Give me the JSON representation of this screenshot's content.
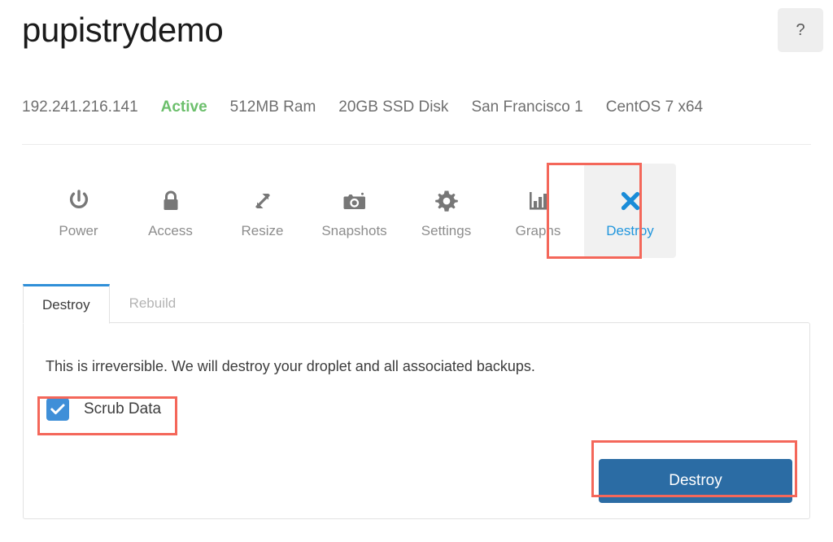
{
  "header": {
    "droplet_name": "pupistrydemo",
    "help_label": "?",
    "help_icon": "question-mark-icon"
  },
  "meta": {
    "items": [
      {
        "label": "192.241.216.141",
        "kind": "ip-address"
      },
      {
        "label": "Active",
        "kind": "status"
      },
      {
        "label": "512MB Ram",
        "kind": "memory"
      },
      {
        "label": "20GB SSD Disk",
        "kind": "disk"
      },
      {
        "label": "San Francisco 1",
        "kind": "region"
      },
      {
        "label": "CentOS 7 x64",
        "kind": "os"
      }
    ]
  },
  "icon_tabs": [
    {
      "label": "Power",
      "icon": "power-icon",
      "active": false
    },
    {
      "label": "Access",
      "icon": "lock-icon",
      "active": false
    },
    {
      "label": "Resize",
      "icon": "resize-icon",
      "active": false
    },
    {
      "label": "Snapshots",
      "icon": "camera-icon",
      "active": false
    },
    {
      "label": "Settings",
      "icon": "gear-icon",
      "active": false
    },
    {
      "label": "Graphs",
      "icon": "bar-chart-icon",
      "active": false
    },
    {
      "label": "Destroy",
      "icon": "x-close-icon",
      "active": true
    }
  ],
  "panel": {
    "tabs": [
      {
        "label": "Destroy",
        "active": true
      },
      {
        "label": "Rebuild",
        "active": false
      }
    ],
    "warning_text": "This is irreversible. We will destroy your droplet and all associated backups.",
    "scrub": {
      "label": "Scrub Data",
      "checked": true,
      "check_icon": "checkmark-icon"
    },
    "submit_label": "Destroy"
  },
  "colors": {
    "accent_blue": "#2196dd",
    "button_blue": "#2b6ca4",
    "checkbox_blue": "#3f8fd8",
    "status_green": "#6cbf6c",
    "annotation_red": "#f4675a",
    "tab_active_border": "#2f8fd8"
  },
  "annotations": [
    {
      "target": "destroy-icon-tab"
    },
    {
      "target": "scrub-data-checkbox"
    },
    {
      "target": "destroy-submit-button"
    }
  ]
}
